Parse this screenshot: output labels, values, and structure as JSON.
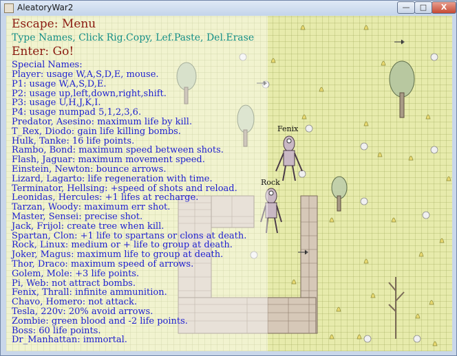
{
  "window": {
    "title": "AleatoryWar2",
    "minimize": "—",
    "maximize": "□",
    "close": "X"
  },
  "menu": {
    "escape": "Escape: Menu",
    "help": "Type Names, Click Rig.Copy, Lef.Paste, Del.Erase",
    "enter": "Enter: Go!",
    "names_header": "Special Names:",
    "names": [
      "Player: usage W,A,S,D,E, mouse.",
      "P1: usage W,A,S,D,E.",
      "P2: usage up,left,down,right,shift.",
      "P3: usage U,H,J,K,I.",
      "P4: usage numpad 5,1,2,3,6.",
      "Predator, Asesino: maximum life by kill.",
      "T_Rex, Diodo: gain life killing bombs.",
      "Hulk, Tanke: 16 life points.",
      "Rambo, Bond: maximum speed between shots.",
      "Flash, Jaguar: maximum movement speed.",
      "Einstein, Newton: bounce arrows.",
      "Lizard, Lagarto: life regeneration with time.",
      "Terminator, Hellsing: +speed of shots and reload.",
      "Leonidas, Hercules: +1 lifes at recharge.",
      "Tarzan, Woody: maximum err shot.",
      "Master, Sensei: precise shot.",
      "Jack, Frijol: create tree when kill.",
      "Spartan, Clon: +1 life to spartans or clons at death.",
      "Rock, Linux: medium or + life to group at death.",
      "Joker, Magus: maximum life to group at death.",
      "Thor, Draco: maximum speed of arrows.",
      "Golem, Mole: +3 life points.",
      "Pi, Web: not attract bombs.",
      "Fenix, Thrall: infinite ammunition.",
      "Chavo, Homero: not attack.",
      "Tesla, 220v: 20% avoid arrows.",
      "Zombie: green blood and -2 life points.",
      "Boss: 60 life points.",
      "Dr_Manhattan: immortal."
    ]
  },
  "characters": [
    {
      "name": "Fenix"
    },
    {
      "name": "Rock"
    }
  ],
  "colors": {
    "menu_red": "#8b1a10",
    "help_teal": "#138e86",
    "names_blue": "#1d1ed0",
    "ground": "#e6eaa8"
  }
}
